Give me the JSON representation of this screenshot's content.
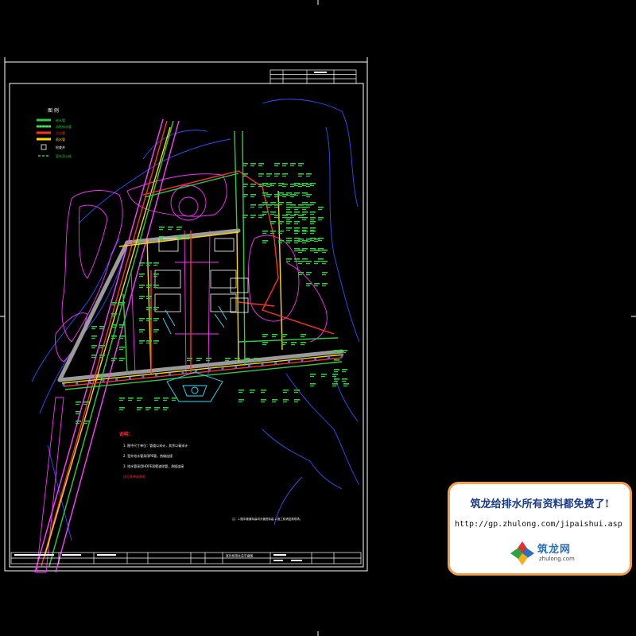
{
  "drawing": {
    "legend": {
      "title": "图 例",
      "items": [
        {
          "label": "给水管",
          "color": "#2ecc40"
        },
        {
          "label": "消防给水管",
          "color": "#2ecc40"
        },
        {
          "label": "污水管",
          "color": "#ff3030"
        },
        {
          "label": "雨水管",
          "color": "#ffd700"
        },
        {
          "label": "检查井",
          "color": "#ffffff"
        },
        {
          "label": "室外消火栓",
          "color": "#2ecc40"
        }
      ]
    },
    "notes": {
      "heading": "说明：",
      "lines": [
        "1. 图中尺寸单位：管道以米计，其余以毫米计",
        "2. 室外给水管采用PE管，热熔连接",
        "3. 排水管采用HDPE双壁波纹管，承插连接"
      ],
      "highlight": "详见各单体图纸"
    },
    "bottom_note": "注：1.图中管道标高均为管底标高 2.施工前请复核现场。",
    "title_block": {
      "drawing_name": "室外给排水总平面图"
    },
    "colors": {
      "frame": "#ffffff",
      "water": "#2ecc40",
      "sewage": "#ff3030",
      "rain": "#ffd700",
      "road": "#ff40ff",
      "terrain": "#4060ff",
      "paving": "#aaaaaa"
    }
  },
  "promo": {
    "title": "筑龙给排水所有资料都免费了!",
    "url": "http://gp.zhulong.com/jipaishui.asp",
    "brand": "筑龙网",
    "domain": "zhulong.com"
  }
}
